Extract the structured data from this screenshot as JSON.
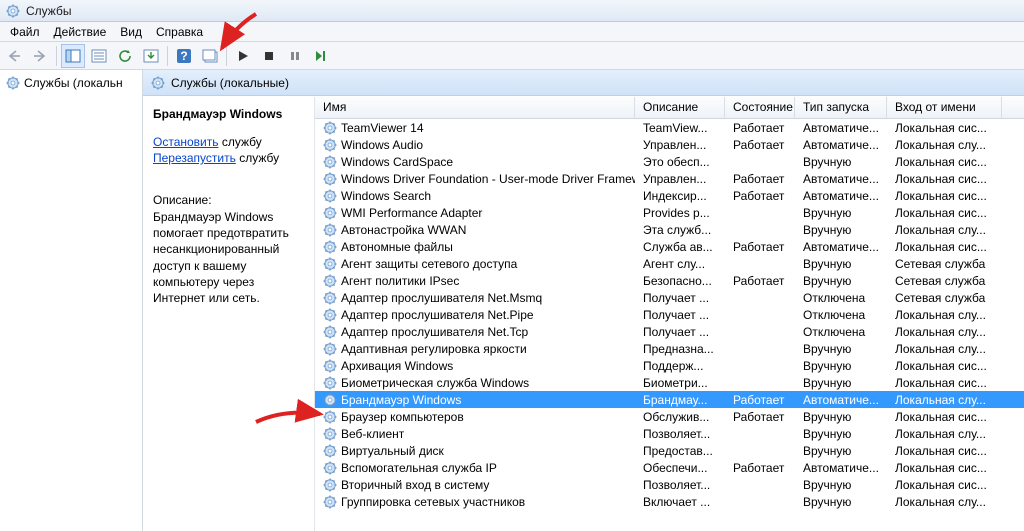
{
  "titlebar": {
    "title": "Службы"
  },
  "menu": {
    "file": "Файл",
    "action": "Действие",
    "view": "Вид",
    "help": "Справка"
  },
  "tree": {
    "root": "Службы (локальн"
  },
  "panel": {
    "title": "Службы (локальные)"
  },
  "detail": {
    "name": "Брандмауэр Windows",
    "stop_link": "Остановить",
    "stop_suffix": " службу",
    "restart_link": "Перезапустить",
    "restart_suffix": " службу",
    "desc_label": "Описание:",
    "desc_text": "Брандмауэр Windows помогает предотвратить несанкционированный доступ к вашему компьютеру через Интернет или сеть."
  },
  "columns": {
    "name": "Имя",
    "desc": "Описание",
    "state": "Состояние",
    "start": "Тип запуска",
    "logon": "Вход от имени"
  },
  "services": [
    {
      "n": "TeamViewer 14",
      "d": "TeamView...",
      "s": "Работает",
      "t": "Автоматиче...",
      "l": "Локальная сис..."
    },
    {
      "n": "Windows Audio",
      "d": "Управлен...",
      "s": "Работает",
      "t": "Автоматиче...",
      "l": "Локальная слу..."
    },
    {
      "n": "Windows CardSpace",
      "d": "Это обесп...",
      "s": "",
      "t": "Вручную",
      "l": "Локальная сис..."
    },
    {
      "n": "Windows Driver Foundation - User-mode Driver Framework",
      "d": "Управлен...",
      "s": "Работает",
      "t": "Автоматиче...",
      "l": "Локальная сис..."
    },
    {
      "n": "Windows Search",
      "d": "Индексир...",
      "s": "Работает",
      "t": "Автоматиче...",
      "l": "Локальная сис..."
    },
    {
      "n": "WMI Performance Adapter",
      "d": "Provides p...",
      "s": "",
      "t": "Вручную",
      "l": "Локальная сис..."
    },
    {
      "n": "Автонастройка WWAN",
      "d": "Эта служб...",
      "s": "",
      "t": "Вручную",
      "l": "Локальная слу..."
    },
    {
      "n": "Автономные файлы",
      "d": "Служба ав...",
      "s": "Работает",
      "t": "Автоматиче...",
      "l": "Локальная сис..."
    },
    {
      "n": "Агент защиты сетевого доступа",
      "d": "Агент слу...",
      "s": "",
      "t": "Вручную",
      "l": "Сетевая служба"
    },
    {
      "n": "Агент политики IPsec",
      "d": "Безопасно...",
      "s": "Работает",
      "t": "Вручную",
      "l": "Сетевая служба"
    },
    {
      "n": "Адаптер прослушивателя Net.Msmq",
      "d": "Получает ...",
      "s": "",
      "t": "Отключена",
      "l": "Сетевая служба"
    },
    {
      "n": "Адаптер прослушивателя Net.Pipe",
      "d": "Получает ...",
      "s": "",
      "t": "Отключена",
      "l": "Локальная слу..."
    },
    {
      "n": "Адаптер прослушивателя Net.Tcp",
      "d": "Получает ...",
      "s": "",
      "t": "Отключена",
      "l": "Локальная слу..."
    },
    {
      "n": "Адаптивная регулировка яркости",
      "d": "Предназна...",
      "s": "",
      "t": "Вручную",
      "l": "Локальная слу..."
    },
    {
      "n": "Архивация Windows",
      "d": "Поддерж...",
      "s": "",
      "t": "Вручную",
      "l": "Локальная сис..."
    },
    {
      "n": "Биометрическая служба Windows",
      "d": "Биометри...",
      "s": "",
      "t": "Вручную",
      "l": "Локальная сис..."
    },
    {
      "n": "Брандмауэр Windows",
      "d": "Брандмау...",
      "s": "Работает",
      "t": "Автоматиче...",
      "l": "Локальная слу...",
      "sel": true
    },
    {
      "n": "Браузер компьютеров",
      "d": "Обслужив...",
      "s": "Работает",
      "t": "Вручную",
      "l": "Локальная сис..."
    },
    {
      "n": "Веб-клиент",
      "d": "Позволяет...",
      "s": "",
      "t": "Вручную",
      "l": "Локальная слу..."
    },
    {
      "n": "Виртуальный диск",
      "d": "Предостав...",
      "s": "",
      "t": "Вручную",
      "l": "Локальная сис..."
    },
    {
      "n": "Вспомогательная служба IP",
      "d": "Обеспечи...",
      "s": "Работает",
      "t": "Автоматиче...",
      "l": "Локальная сис..."
    },
    {
      "n": "Вторичный вход в систему",
      "d": "Позволяет...",
      "s": "",
      "t": "Вручную",
      "l": "Локальная сис..."
    },
    {
      "n": "Группировка сетевых участников",
      "d": "Включает ...",
      "s": "",
      "t": "Вручную",
      "l": "Локальная слу..."
    }
  ]
}
